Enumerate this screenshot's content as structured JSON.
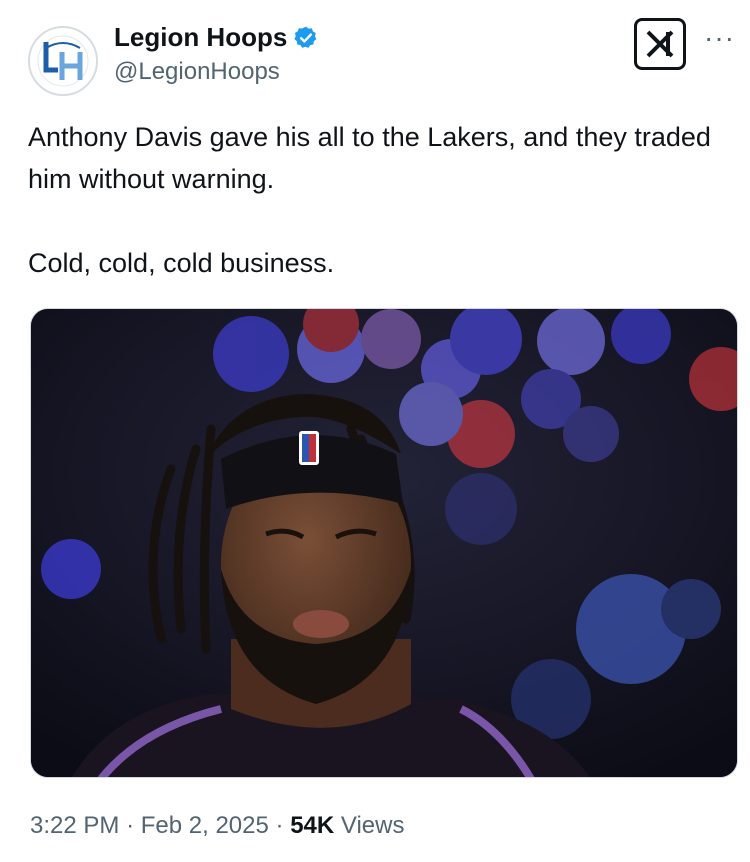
{
  "account": {
    "name": "Legion Hoops",
    "handle": "@LegionHoops",
    "avatar_text": "LH"
  },
  "icons": {
    "verified": "verified-badge-icon",
    "x_logo": "x-logo-icon",
    "more": "more-options-icon"
  },
  "tweet": {
    "text": "Anthony Davis gave his all to the Lakers, and they traded him without warning.\n\nCold, cold, cold business."
  },
  "media": {
    "alt": "",
    "description_colors": {
      "bg": "#12121e",
      "blue": "#4b4ad6",
      "red": "#c3343a"
    }
  },
  "meta": {
    "time": "3:22 PM",
    "sep1": "·",
    "date": "Feb 2, 2025",
    "sep2": "·",
    "views_count": "54K",
    "views_label": "Views"
  },
  "colors": {
    "verified": "#1d9bf0",
    "text": "#0f1419",
    "secondary": "#536471"
  }
}
